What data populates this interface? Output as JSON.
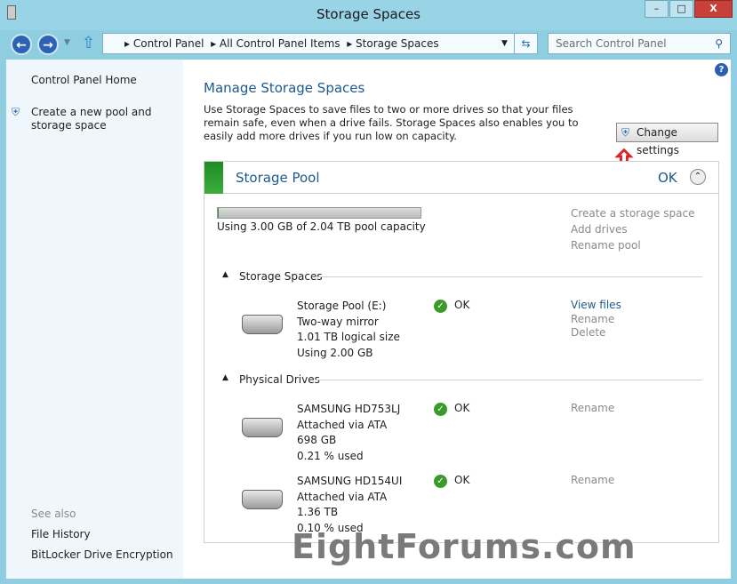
{
  "window": {
    "title": "Storage Spaces",
    "minimize": "–",
    "maximize": "□",
    "close": "X"
  },
  "nav": {
    "back": "←",
    "forward": "→",
    "up": "⇧",
    "breadcrumb": [
      "Control Panel",
      "All Control Panel Items",
      "Storage Spaces"
    ],
    "search_placeholder": "Search Control Panel"
  },
  "sidebar": {
    "home": "Control Panel Home",
    "create": "Create a new pool and storage space",
    "see_also": "See also",
    "links": [
      "File History",
      "BitLocker Drive Encryption"
    ]
  },
  "main": {
    "title": "Manage Storage Spaces",
    "description": "Use Storage Spaces to save files to two or more drives so that your files remain safe, even when a drive fails. Storage Spaces also enables you to easily add more drives if you run low on capacity.",
    "change_settings": "Change settings",
    "pool": {
      "name": "Storage Pool",
      "status": "OK",
      "usage_text": "Using 3.00 GB of 2.04 TB pool capacity",
      "usage_fraction": 0.0015,
      "actions": [
        "Create a storage space",
        "Add drives",
        "Rename pool"
      ],
      "spaces_header": "Storage Spaces",
      "spaces": [
        {
          "lines": [
            "Storage Pool (E:)",
            "Two-way mirror",
            "1.01 TB logical size",
            "Using 2.00 GB"
          ],
          "status": "OK",
          "actions": [
            "View files",
            "Rename",
            "Delete"
          ]
        }
      ],
      "drives_header": "Physical Drives",
      "drives": [
        {
          "lines": [
            "SAMSUNG HD753LJ",
            "Attached via ATA",
            "698 GB",
            "0.21 % used"
          ],
          "status": "OK",
          "action": "Rename"
        },
        {
          "lines": [
            "SAMSUNG HD154UI",
            "Attached via ATA",
            "1.36 TB",
            "0.10 % used"
          ],
          "status": "OK",
          "action": "Rename"
        }
      ]
    }
  },
  "watermark": "EightForums.com",
  "colors": {
    "accent": "#1c5a8f",
    "pool_ok": "#2e9a2e",
    "arrow": "#e0202a"
  }
}
